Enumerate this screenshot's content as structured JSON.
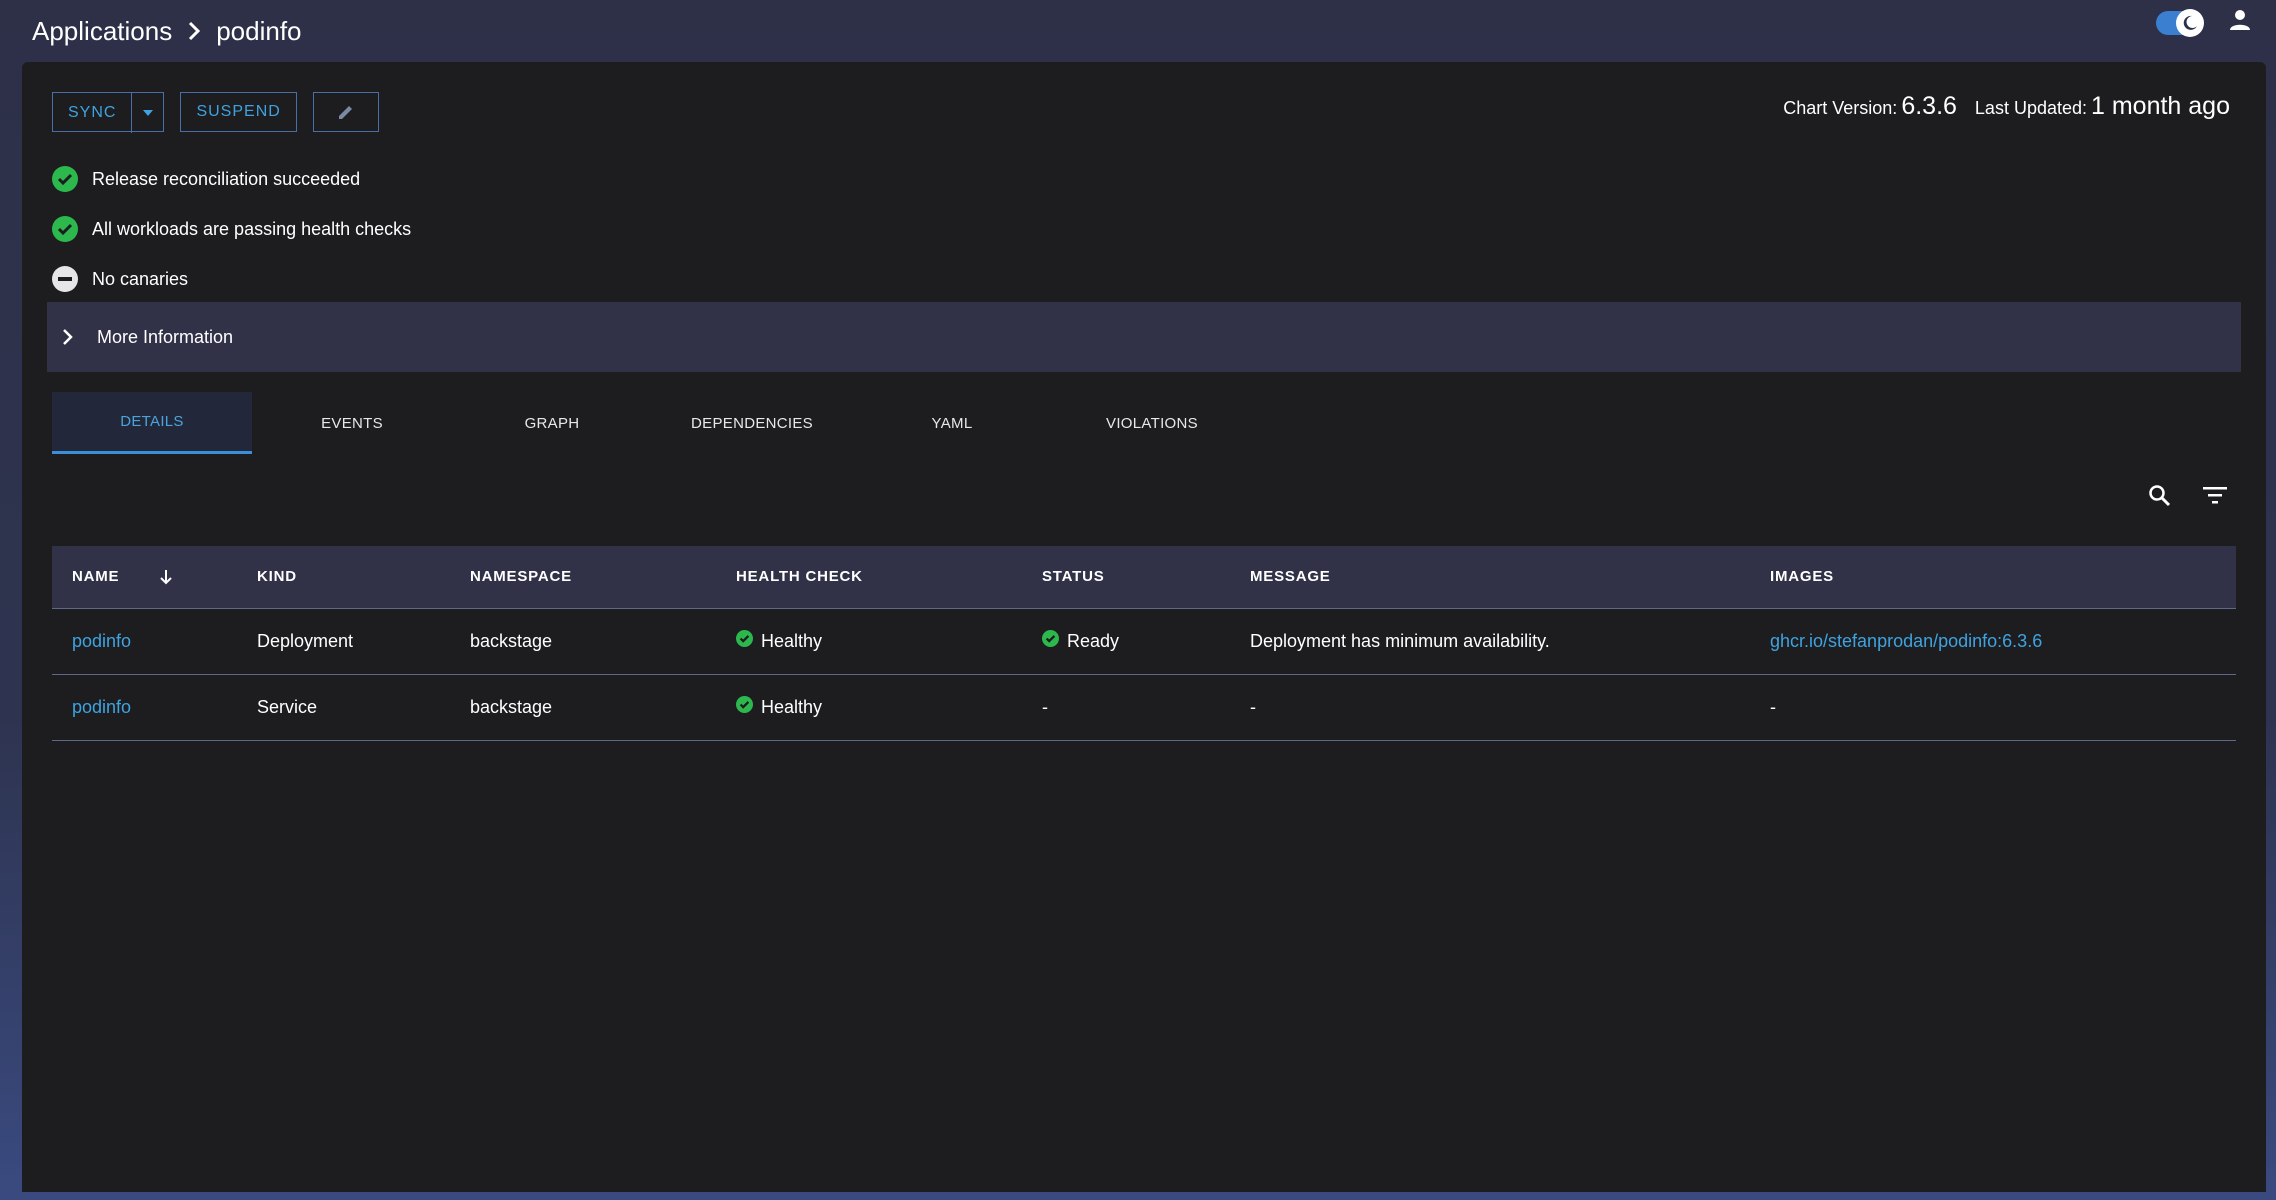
{
  "breadcrumb": {
    "root": "Applications",
    "current": "podinfo"
  },
  "toolbar": {
    "sync_label": "SYNC",
    "suspend_label": "SUSPEND"
  },
  "chart_meta": {
    "chart_version_label": "Chart Version:",
    "chart_version": "6.3.6",
    "last_updated_label": "Last Updated:",
    "last_updated": "1 month ago"
  },
  "checks": [
    {
      "label": "Release reconciliation succeeded",
      "icon": "check-circle-icon"
    },
    {
      "label": "All workloads are passing health checks",
      "icon": "check-circle-icon"
    },
    {
      "label": "No canaries",
      "icon": "minus-circle-icon"
    }
  ],
  "more_info": {
    "label": "More Information"
  },
  "tabs": [
    {
      "label": "DETAILS",
      "active": true
    },
    {
      "label": "EVENTS"
    },
    {
      "label": "GRAPH"
    },
    {
      "label": "DEPENDENCIES"
    },
    {
      "label": "YAML"
    },
    {
      "label": "VIOLATIONS"
    }
  ],
  "table": {
    "columns": [
      "NAME",
      "KIND",
      "NAMESPACE",
      "HEALTH CHECK",
      "STATUS",
      "MESSAGE",
      "IMAGES"
    ],
    "rows": [
      {
        "name": "podinfo",
        "kind": "Deployment",
        "namespace": "backstage",
        "health": "Healthy",
        "status": "Ready",
        "message": "Deployment has minimum availability.",
        "images": "ghcr.io/stefanprodan/podinfo:6.3.6"
      },
      {
        "name": "podinfo",
        "kind": "Service",
        "namespace": "backstage",
        "health": "Healthy",
        "status": "-",
        "message": "-",
        "images": "-"
      }
    ]
  },
  "colors": {
    "accent": "#3ea3e0",
    "success": "#2db84d",
    "panel": "#1d1d1f"
  }
}
